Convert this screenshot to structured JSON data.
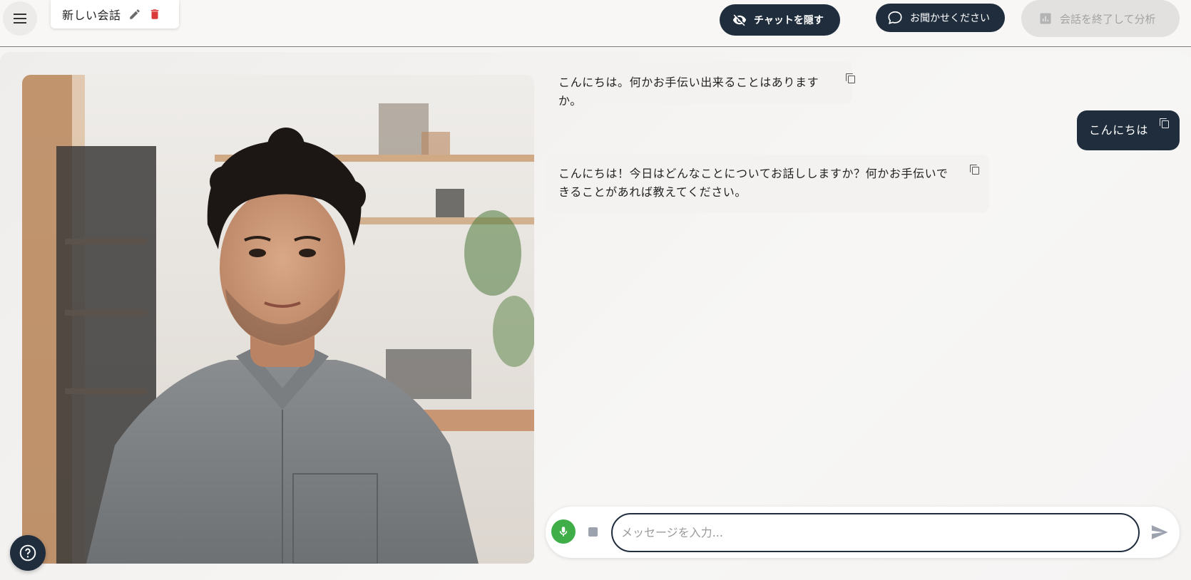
{
  "header": {
    "session_title": "新しい会話",
    "hide_chat_label": "チャットを隠す",
    "feedback_label": "お聞かせください",
    "end_analyze_label": "会話を終了して分析",
    "icons": [
      "menu-icon",
      "edit-icon",
      "delete-icon",
      "eye-off-icon",
      "chat-bubble-icon",
      "bar-chart-icon"
    ],
    "colors": {
      "dark": "#1f2d3d",
      "delete": "#dc3b3b",
      "mic": "#3fae49"
    }
  },
  "messages": [
    {
      "role": "assistant",
      "text": "こんにちは。何かお手伝い出来ることはありますか。"
    },
    {
      "role": "user",
      "text": "こんにちは"
    },
    {
      "role": "assistant",
      "text": "こんにちは！今日はどんなことについてお話ししますか？何かお手伝いできることがあれば教えてください。"
    }
  ],
  "composer": {
    "placeholder": "メッセージを入力...",
    "value": ""
  }
}
